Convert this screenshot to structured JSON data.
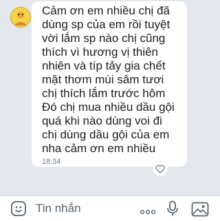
{
  "message": {
    "lines": [
      "Cảm ơn em nhiều  chị đã",
      "dùng sp của em  rồi tuyệt",
      "vời lắm sp nào chị cũng",
      "thích vì hương vị thiên",
      "nhiên  và típ tảy gia chết",
      "mặt thơm mùi sâm tươi",
      "chị thích lắm trước hôm",
      "Đó chị mua nhiều dầu gội",
      "quá  khi nào dùng voi đi",
      "chị dùng dầu gội của em",
      "nha cảm ơn em nhiều"
    ],
    "time": "18:34"
  },
  "input": {
    "placeholder": "Tin nhắn"
  },
  "icons": {
    "avatar": "avatar-image",
    "react": "heart-outline-icon",
    "emoji": "smiley-icon",
    "more": "ellipsis-icon",
    "mic": "microphone-icon",
    "image": "image-icon"
  },
  "colors": {
    "background": "#e4e8ed",
    "bubble": "#ffffff",
    "accent": "#1a6fd8"
  }
}
